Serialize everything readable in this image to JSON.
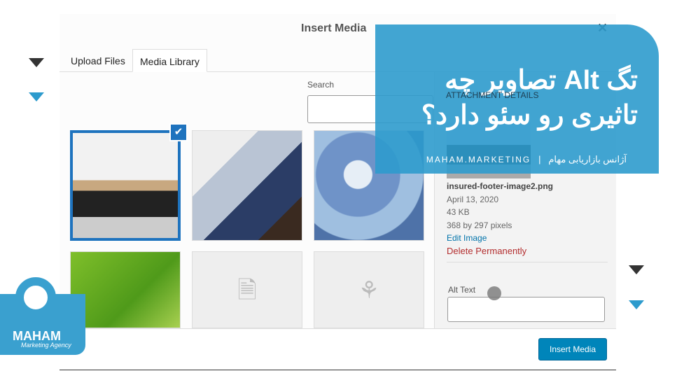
{
  "dialog": {
    "title": "Insert Media",
    "close_icon": "close-icon",
    "tabs": [
      {
        "label": "Upload Files"
      },
      {
        "label": "Media Library"
      }
    ],
    "search": {
      "label": "Search",
      "value": ""
    },
    "attachment": {
      "heading": "ATTACHMENT DETAILS",
      "filename": "insured-footer-image2.png",
      "date": "April 13, 2020",
      "size": "43 KB",
      "dimensions": "368 by 297 pixels",
      "edit_link": "Edit Image",
      "delete_link": "Delete Permanently",
      "alt_label": "Alt Text",
      "alt_value": ""
    },
    "insert_button": "Insert Media",
    "check_icon": "✔",
    "file_icons": [
      "🗎",
      "⚘"
    ]
  },
  "banner": {
    "title_line1": "تگ Alt تصاویر چه",
    "title_line2": "تاثیری رو سئو دارد؟",
    "brand_en": "MAHAM.MARKETING",
    "brand_sep": "|",
    "brand_fa": "آژانس بازاریابی مهام",
    "color": "#2d9bcd"
  },
  "logo": {
    "name": "MAHAM",
    "tagline": "Marketing Agency"
  }
}
